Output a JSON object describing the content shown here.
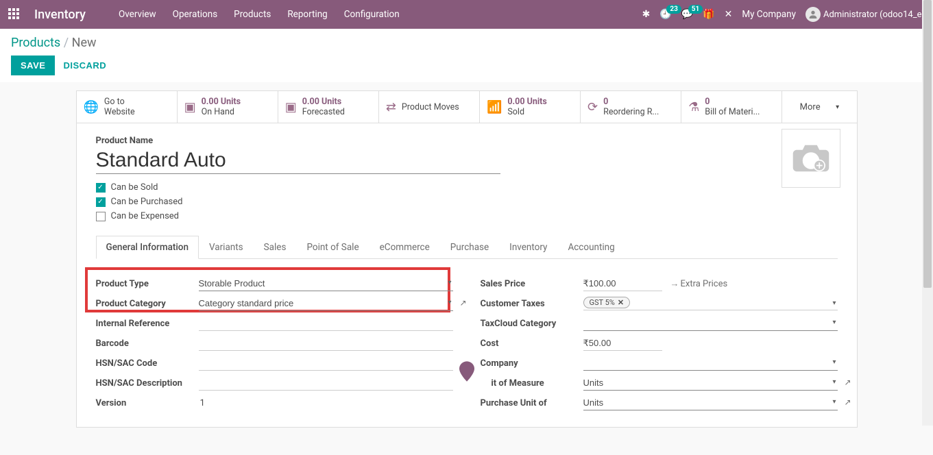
{
  "topbar": {
    "brand": "Inventory",
    "menu": [
      "Overview",
      "Operations",
      "Products",
      "Reporting",
      "Configuration"
    ],
    "activity_count": "23",
    "discuss_count": "51",
    "company": "My Company",
    "user": "Administrator (odoo14_e)"
  },
  "breadcrumb": {
    "parent": "Products",
    "current": "New"
  },
  "buttons": {
    "save": "SAVE",
    "discard": "DISCARD"
  },
  "stat_buttons": {
    "website": {
      "l1": "Go to",
      "l2": "Website"
    },
    "onhand": {
      "val": "0.00 Units",
      "label": "On Hand"
    },
    "forecast": {
      "val": "0.00 Units",
      "label": "Forecasted"
    },
    "moves": {
      "label": "Product Moves"
    },
    "sold": {
      "val": "0.00 Units",
      "label": "Sold"
    },
    "reorder": {
      "val": "0",
      "label": "Reordering R..."
    },
    "bom": {
      "val": "0",
      "label": "Bill of Materi..."
    },
    "more": "More"
  },
  "product": {
    "name_label": "Product Name",
    "name": "Standard Auto",
    "can_sold": "Can be Sold",
    "can_purchased": "Can be Purchased",
    "can_expensed": "Can be Expensed"
  },
  "tabs": [
    "General Information",
    "Variants",
    "Sales",
    "Point of Sale",
    "eCommerce",
    "Purchase",
    "Inventory",
    "Accounting"
  ],
  "left": {
    "product_type_label": "Product Type",
    "product_type": "Storable Product",
    "category_label": "Product Category",
    "category": "Category standard price",
    "internal_ref_label": "Internal Reference",
    "barcode_label": "Barcode",
    "hsn_code_label": "HSN/SAC Code",
    "hsn_desc_label": "HSN/SAC Description",
    "version_label": "Version",
    "version": "1"
  },
  "right": {
    "sales_price_label": "Sales Price",
    "sales_price": "₹100.00",
    "extra_prices": "Extra Prices",
    "cust_tax_label": "Customer Taxes",
    "cust_tax": "GST 5%",
    "taxcloud_label": "TaxCloud Category",
    "cost_label": "Cost",
    "cost": "₹50.00",
    "company_label": "Company",
    "uom_label": "Unit of Measure",
    "uom": "Units",
    "purchase_uom_label": "Purchase Unit of",
    "purchase_uom": "Units"
  }
}
